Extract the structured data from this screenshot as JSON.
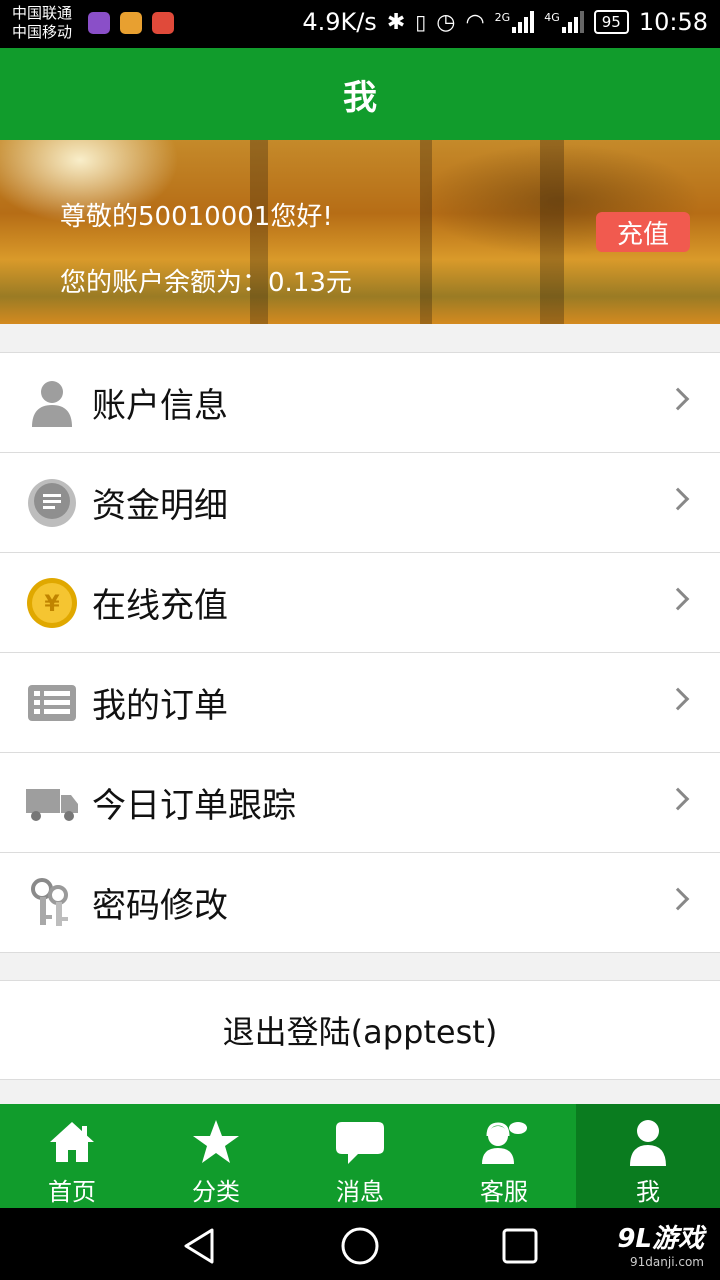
{
  "status_bar": {
    "carrier1": "中国联通",
    "carrier2": "中国移动",
    "net_speed": "4.9K/s",
    "net2": "2G",
    "net4": "4G",
    "battery": "95",
    "time": "10:58"
  },
  "header": {
    "title": "我"
  },
  "banner": {
    "greeting": "尊敬的50010001您好!",
    "balance": "您的账户余额为：0.13元",
    "recharge_label": "充值"
  },
  "menu": {
    "items": [
      {
        "label": "账户信息",
        "icon": "user-icon"
      },
      {
        "label": "资金明细",
        "icon": "chat-list-icon"
      },
      {
        "label": "在线充值",
        "icon": "yen-coin-icon"
      },
      {
        "label": "我的订单",
        "icon": "list-icon"
      },
      {
        "label": "今日订单跟踪",
        "icon": "truck-icon"
      },
      {
        "label": "密码修改",
        "icon": "keys-icon"
      }
    ]
  },
  "logout": {
    "label": "退出登陆(apptest)"
  },
  "tabs": [
    {
      "label": "首页",
      "icon": "home-icon"
    },
    {
      "label": "分类",
      "icon": "star-icon"
    },
    {
      "label": "消息",
      "icon": "message-icon"
    },
    {
      "label": "客服",
      "icon": "customer-service-icon"
    },
    {
      "label": "我",
      "icon": "person-icon",
      "active": true
    }
  ],
  "watermark": {
    "logo": "9L游戏",
    "site": "91danji.com"
  },
  "colors": {
    "primary": "#119c2c",
    "active_tab": "#0a7c1f",
    "recharge": "#f15a4f"
  }
}
